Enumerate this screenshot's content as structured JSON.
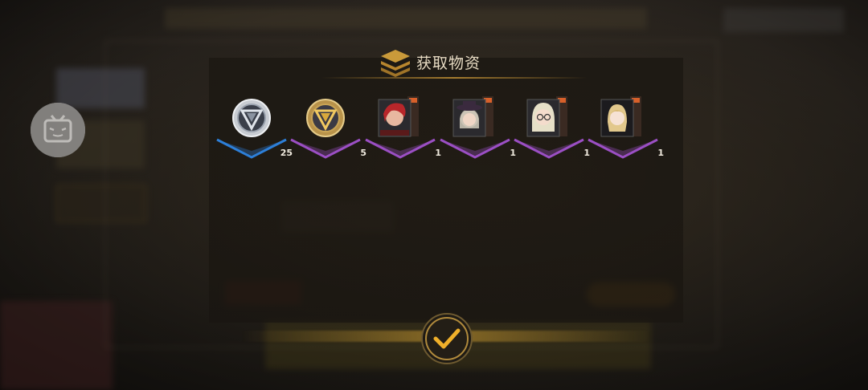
{
  "dialog": {
    "title": "获取物资",
    "confirm_icon": "checkmark-icon"
  },
  "items": [
    {
      "name": "silver-badge",
      "count": "25",
      "rarity": "blue"
    },
    {
      "name": "gold-badge",
      "count": "5",
      "rarity": "purple"
    },
    {
      "name": "character-card-red-hair",
      "count": "1",
      "rarity": "purple"
    },
    {
      "name": "character-card-hat",
      "count": "1",
      "rarity": "purple"
    },
    {
      "name": "character-card-glasses",
      "count": "1",
      "rarity": "purple"
    },
    {
      "name": "character-card-blonde",
      "count": "1",
      "rarity": "purple"
    }
  ],
  "colors": {
    "accent_gold": "#d9a63a",
    "rarity_blue": "#2d7fd8",
    "rarity_purple": "#9b4fc4",
    "title_text": "#e8dcc4"
  },
  "overlay": {
    "avatar_icon": "tv-face-icon"
  }
}
